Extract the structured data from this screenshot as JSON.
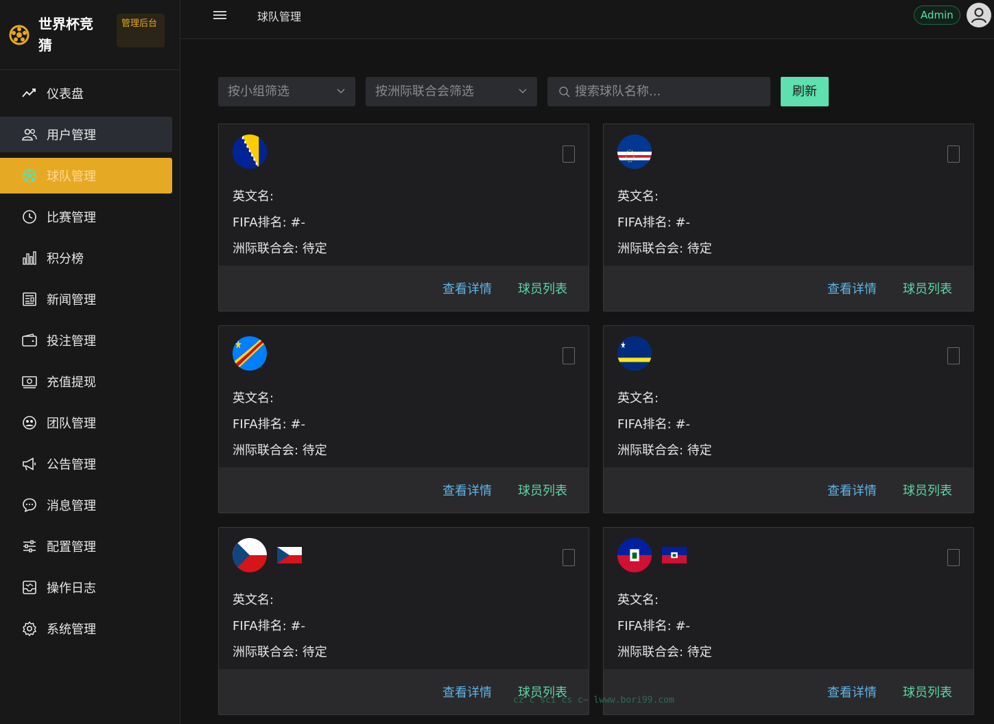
{
  "brand": {
    "title": "世界杯竞猜",
    "badge": "管理后台",
    "logo_icon": "soccer-ball-icon",
    "accent": "#e6a924"
  },
  "sidebar": {
    "items": [
      {
        "label": "仪表盘",
        "icon": "trend-line-icon"
      },
      {
        "label": "用户管理",
        "icon": "users-icon"
      },
      {
        "label": "球队管理",
        "icon": "soccer-ball-icon"
      },
      {
        "label": "比赛管理",
        "icon": "clock-icon"
      },
      {
        "label": "积分榜",
        "icon": "bar-chart-icon"
      },
      {
        "label": "新闻管理",
        "icon": "newspaper-icon"
      },
      {
        "label": "投注管理",
        "icon": "wallet-icon"
      },
      {
        "label": "充值提现",
        "icon": "money-icon"
      },
      {
        "label": "团队管理",
        "icon": "team-icon"
      },
      {
        "label": "公告管理",
        "icon": "megaphone-icon"
      },
      {
        "label": "消息管理",
        "icon": "chat-icon"
      },
      {
        "label": "配置管理",
        "icon": "sliders-icon"
      },
      {
        "label": "操作日志",
        "icon": "inbox-icon"
      },
      {
        "label": "系统管理",
        "icon": "gear-icon"
      }
    ],
    "active_index": 2,
    "hover_index": 1
  },
  "header": {
    "breadcrumb": "球队管理",
    "user_label": "Admin"
  },
  "filters": {
    "group_placeholder": "按小组筛选",
    "confed_placeholder": "按洲际联合会筛选",
    "search_placeholder": "搜索球队名称...",
    "refresh_label": "刷新"
  },
  "cards": [
    {
      "flag": "bosnia",
      "small_flag": false,
      "english_name_label": "英文名:",
      "fifa_label": "FIFA排名: #-",
      "confed_label": "洲际联合会: 待定",
      "detail_label": "查看详情",
      "players_label": "球员列表"
    },
    {
      "flag": "cape-verde",
      "small_flag": false,
      "english_name_label": "英文名:",
      "fifa_label": "FIFA排名: #-",
      "confed_label": "洲际联合会: 待定",
      "detail_label": "查看详情",
      "players_label": "球员列表"
    },
    {
      "flag": "dr-congo",
      "small_flag": false,
      "english_name_label": "英文名:",
      "fifa_label": "FIFA排名: #-",
      "confed_label": "洲际联合会: 待定",
      "detail_label": "查看详情",
      "players_label": "球员列表"
    },
    {
      "flag": "curacao",
      "small_flag": false,
      "english_name_label": "英文名:",
      "fifa_label": "FIFA排名: #-",
      "confed_label": "洲际联合会: 待定",
      "detail_label": "查看详情",
      "players_label": "球员列表"
    },
    {
      "flag": "czech",
      "small_flag": true,
      "english_name_label": "英文名:",
      "fifa_label": "FIFA排名: #-",
      "confed_label": "洲际联合会: 待定",
      "detail_label": "查看详情",
      "players_label": "球员列表"
    },
    {
      "flag": "haiti",
      "small_flag": true,
      "english_name_label": "英文名:",
      "fifa_label": "FIFA排名: #-",
      "confed_label": "洲际联合会: 待定",
      "detail_label": "查看详情",
      "players_label": "球员列表"
    }
  ],
  "watermark": "cz c sci cs c~ lwww.bori99.com"
}
